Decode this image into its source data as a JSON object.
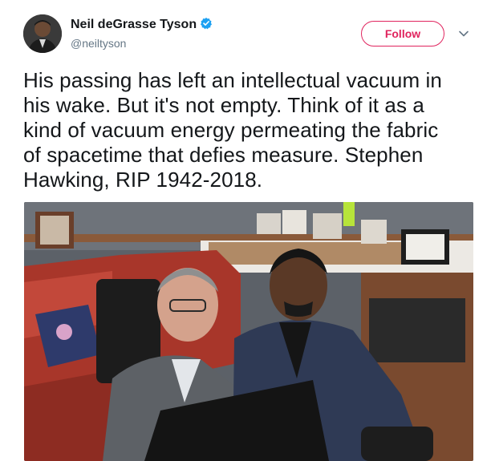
{
  "user": {
    "display_name": "Neil deGrasse Tyson",
    "handle": "@neiltyson",
    "verified_icon": "verified-badge-icon",
    "avatar_icon": "avatar"
  },
  "follow": {
    "label": "Follow",
    "accent": "#e0245e"
  },
  "menu": {
    "icon": "chevron-down-icon"
  },
  "tweet": {
    "text": "His passing has left an intellectual vacuum in\nhis wake. But it's not empty. Think of it as a\nkind of vacuum energy permeating the fabric\nof spacetime that defies measure. Stephen\nHawking, RIP 1942-2018."
  },
  "media": {
    "type": "photo"
  },
  "colors": {
    "text": "#14171a",
    "secondary": "#657786",
    "verified": "#1da1f2"
  }
}
